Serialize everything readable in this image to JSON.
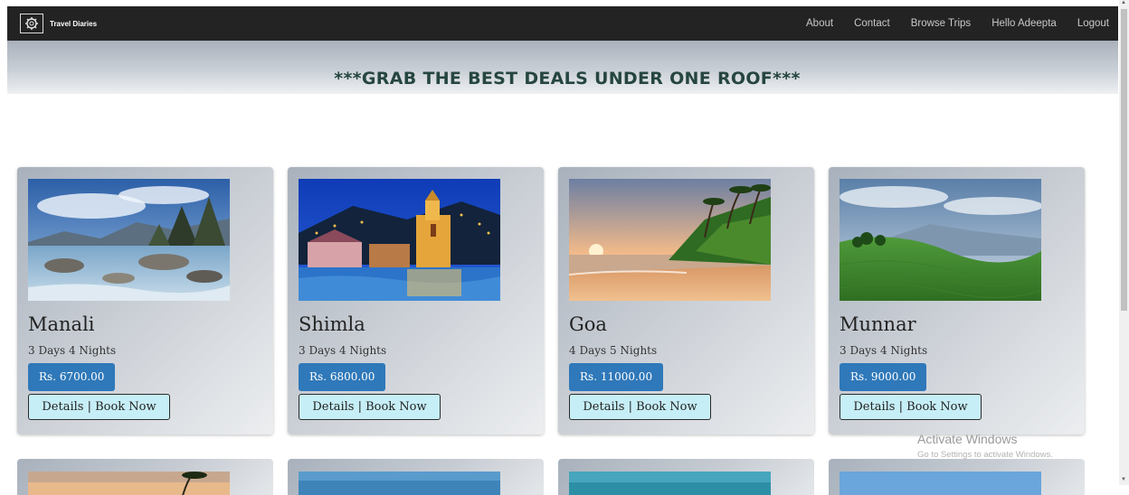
{
  "navbar": {
    "brand": "Travel Diaries",
    "links": [
      "About",
      "Contact",
      "Browse Trips",
      "Hello Adeepta",
      "Logout"
    ]
  },
  "banner": {
    "text": "***GRAB THE BEST DEALS UNDER ONE ROOF***"
  },
  "trips": [
    {
      "name": "Manali",
      "duration": "3 Days 4 Nights",
      "price": "Rs. 6700.00",
      "action": "Details | Book Now"
    },
    {
      "name": "Shimla",
      "duration": "3 Days 4 Nights",
      "price": "Rs. 6800.00",
      "action": "Details | Book Now"
    },
    {
      "name": "Goa",
      "duration": "4 Days 5 Nights",
      "price": "Rs. 11000.00",
      "action": "Details | Book Now"
    },
    {
      "name": "Munnar",
      "duration": "3 Days 4 Nights",
      "price": "Rs. 9000.00",
      "action": "Details | Book Now"
    }
  ],
  "watermark": {
    "title": "Activate Windows",
    "subtitle": "Go to Settings to activate Windows."
  },
  "colors": {
    "navbar": "#232323",
    "price_button": "#2f78b9",
    "book_button": "#c6eef6",
    "banner_text": "#264640"
  },
  "icons": [
    "gear-logo-icon"
  ]
}
